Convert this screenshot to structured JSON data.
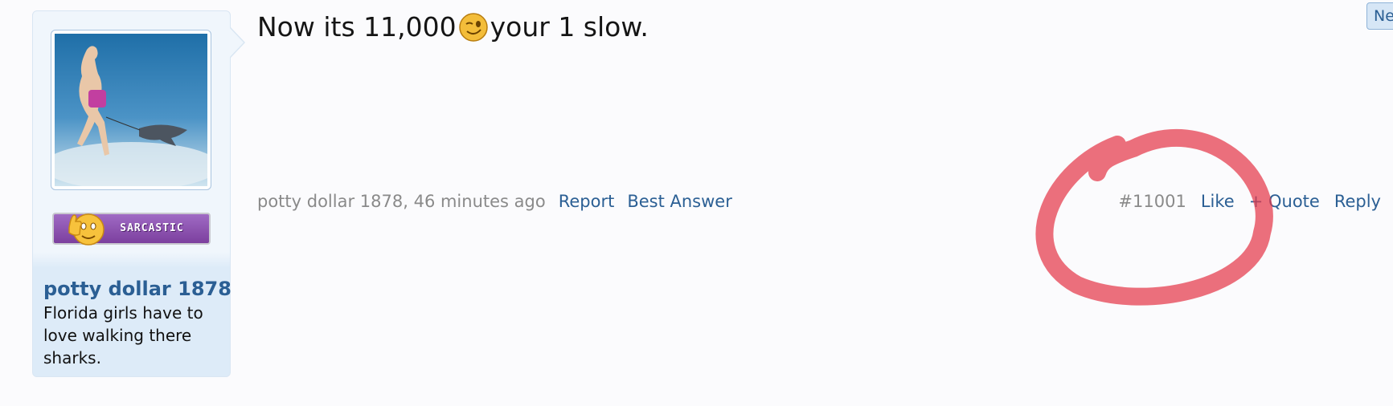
{
  "post": {
    "message_before": "Now its 11,000",
    "message_emoji": "wink-emoji",
    "message_after": "your 1 slow.",
    "author": "potty dollar 1878",
    "time": "46 minutes ago",
    "actions_left": {
      "report": "Report",
      "best_answer": "Best Answer"
    },
    "number": "#11001",
    "actions_right": {
      "like": "Like",
      "quote": "+ Quote",
      "reply": "Reply"
    }
  },
  "user": {
    "name": "potty dollar 1878",
    "title": "Florida girls have to love walking there sharks.",
    "badge": "SARCASTIC",
    "avatar": "woman-walking-shark-underwater"
  },
  "top_right_button": "Ne",
  "colors": {
    "link": "#2b5f94",
    "muted": "#8a8a8a",
    "badge": "#8c4fb0",
    "annotation": "#e5394a"
  }
}
